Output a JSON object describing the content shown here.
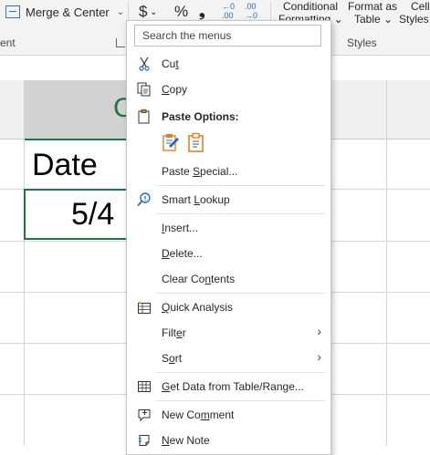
{
  "ribbon": {
    "merge_label": "Merge & Center",
    "merge_chevron": "⌄",
    "alignment_group_label": "ent",
    "currency_symbol": "$",
    "currency_chevron": "⌄",
    "percent_symbol": "%",
    "comma_symbol": "❟",
    "decimal_increase": "←0 .00",
    "decimal_decrease": ".00 →0",
    "conditional_label": "Conditional",
    "formatting_label": "Formatting ⌄",
    "format_as_label": "Format as",
    "table_label": "Table ⌄",
    "cell_label": "Cell",
    "styles_label": "Styles",
    "styles_group_label": "Styles"
  },
  "grid": {
    "column_letter": "C",
    "header_cell": "Date",
    "value_cell": "5/4"
  },
  "menu": {
    "search_placeholder": "Search the menus",
    "items": [
      {
        "id": "cut",
        "label_pre": "Cu",
        "accel": "t",
        "label_post": "",
        "icon": "scissors-icon"
      },
      {
        "id": "copy",
        "label_pre": "",
        "accel": "C",
        "label_post": "opy",
        "icon": "copy-icon"
      },
      {
        "id": "paste-options",
        "label": "Paste Options:",
        "icon": "clipboard-icon"
      },
      {
        "id": "paste-special",
        "label_pre": "Paste ",
        "accel": "S",
        "label_post": "pecial...",
        "icon": ""
      },
      {
        "id": "smart-lookup",
        "label_pre": "Smart ",
        "accel": "L",
        "label_post": "ookup",
        "icon": "smart-lookup-icon"
      },
      {
        "id": "insert",
        "label_pre": "",
        "accel": "I",
        "label_post": "nsert...",
        "icon": ""
      },
      {
        "id": "delete",
        "label_pre": "",
        "accel": "D",
        "label_post": "elete...",
        "icon": ""
      },
      {
        "id": "clear-contents",
        "label_pre": "Clear Co",
        "accel": "n",
        "label_post": "tents",
        "icon": ""
      },
      {
        "id": "quick-analysis",
        "label_pre": "",
        "accel": "Q",
        "label_post": "uick Analysis",
        "icon": "quick-analysis-icon"
      },
      {
        "id": "filter",
        "label_pre": "Filt",
        "accel": "e",
        "label_post": "r",
        "icon": "",
        "submenu": "›"
      },
      {
        "id": "sort",
        "label_pre": "S",
        "accel": "o",
        "label_post": "rt",
        "icon": "",
        "submenu": "›"
      },
      {
        "id": "get-data",
        "label_pre": "",
        "accel": "G",
        "label_post": "et Data from Table/Range...",
        "icon": "table-icon"
      },
      {
        "id": "new-comment",
        "label_pre": "New Co",
        "accel": "m",
        "label_post": "ment",
        "icon": "comment-icon"
      },
      {
        "id": "new-note",
        "label_pre": "",
        "accel": "N",
        "label_post": "ew Note",
        "icon": "note-icon"
      }
    ]
  },
  "colors": {
    "accent_green": "#217346",
    "icon_blue": "#2b6cb0",
    "icon_orange": "#d9822b"
  }
}
